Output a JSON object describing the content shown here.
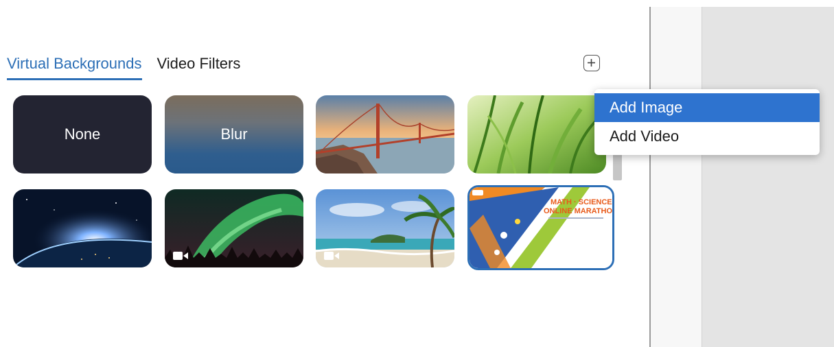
{
  "tabs": [
    {
      "label": "Virtual Backgrounds",
      "active": true
    },
    {
      "label": "Video Filters",
      "active": false
    }
  ],
  "add_button": {
    "icon": "plus-icon"
  },
  "backgrounds": [
    {
      "label": "None",
      "kind": "solid"
    },
    {
      "label": "Blur",
      "kind": "blur"
    },
    {
      "label": "",
      "kind": "golden-gate-bridge"
    },
    {
      "label": "",
      "kind": "grass"
    },
    {
      "label": "",
      "kind": "earth-from-space"
    },
    {
      "label": "",
      "kind": "aurora",
      "video": true
    },
    {
      "label": "",
      "kind": "beach",
      "video": true
    },
    {
      "label": "",
      "kind": "custom-image",
      "selected": true,
      "text_lines": [
        "MATH · SCIENCE",
        "ONLINE MARATHON"
      ]
    }
  ],
  "menu": {
    "items": [
      {
        "label": "Add Image",
        "highlighted": true
      },
      {
        "label": "Add Video",
        "highlighted": false
      }
    ]
  },
  "colors": {
    "accent": "#2d6fb6",
    "menu_highlight": "#2e73cf",
    "none_tile": "#232432"
  }
}
